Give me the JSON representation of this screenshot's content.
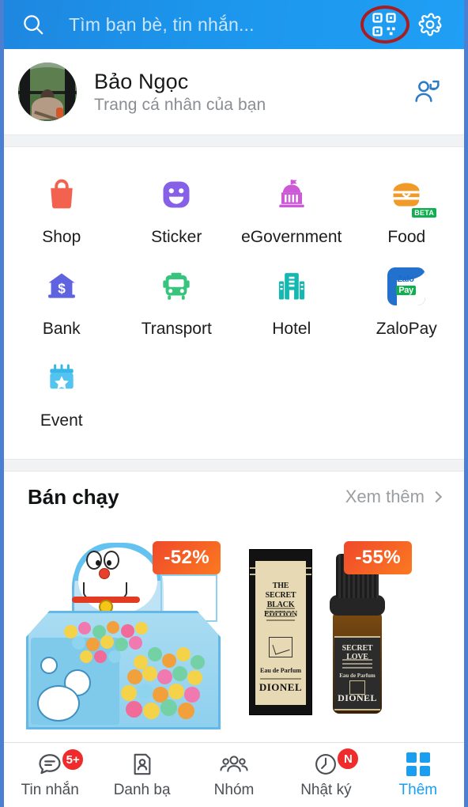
{
  "header": {
    "search_placeholder": "Tìm bạn bè, tin nhắn...",
    "search_icon": "search-icon",
    "qr_icon": "qr-code-icon",
    "settings_icon": "gear-icon",
    "background_color": "#1c96ec",
    "annotation_color": "#a81d20"
  },
  "profile": {
    "name": "Bảo Ngọc",
    "subtitle": "Trang cá nhân của bạn",
    "avatar_icon": "avatar",
    "switch_account_icon": "switch-account-icon"
  },
  "mini_apps": [
    {
      "label": "Shop",
      "icon": "shopping-bag-icon",
      "color": "#f2624f",
      "badge": ""
    },
    {
      "label": "Sticker",
      "icon": "smiley-sticker-icon",
      "color": "#8661e8",
      "badge": ""
    },
    {
      "label": "eGovernment",
      "icon": "government-building-icon",
      "color": "#cc5ad6",
      "badge": ""
    },
    {
      "label": "Food",
      "icon": "burger-icon",
      "color": "#f29a28",
      "badge": "BETA"
    },
    {
      "label": "Bank",
      "icon": "bank-dollar-icon",
      "color": "#5f63e0",
      "badge": ""
    },
    {
      "label": "Transport",
      "icon": "bus-icon",
      "color": "#39c47e",
      "badge": ""
    },
    {
      "label": "Hotel",
      "icon": "hotel-building-icon",
      "color": "#14b8b0",
      "badge": ""
    },
    {
      "label": "ZaloPay",
      "icon": "zalopay-icon",
      "color": "#2272cd",
      "badge": ""
    },
    {
      "label": "Event",
      "icon": "calendar-star-icon",
      "color": "#36b7e8",
      "badge": ""
    }
  ],
  "zalopay_tile": {
    "top_text": "Zalo",
    "bottom_text": "Pay"
  },
  "best_sellers": {
    "title": "Bán chạy",
    "more_label": "Xem thêm",
    "more_icon": "chevron-right-icon",
    "products": [
      {
        "discount": "-52%",
        "image_name": "doraemon-ball-pit-tent-image"
      },
      {
        "discount": "-55%",
        "image_name": "dionel-secret-love-perfume-image",
        "box_title_line1": "THE SECRET",
        "box_title_line2": "BLACK EDITION",
        "box_edp": "Eau de Parfum",
        "box_brand": "DIONEL",
        "bottle_title": "SECRET LOVE",
        "bottle_edp": "Eau de Parfum",
        "bottle_brand": "DIONEL"
      },
      {
        "discount": "",
        "image_name": "white-earphone-image"
      }
    ]
  },
  "bottom_nav": [
    {
      "label": "Tin nhắn",
      "icon": "chat-bubble-icon",
      "badge": "5+",
      "active": false
    },
    {
      "label": "Danh bạ",
      "icon": "contact-card-icon",
      "badge": "",
      "active": false
    },
    {
      "label": "Nhóm",
      "icon": "group-people-icon",
      "badge": "",
      "active": false
    },
    {
      "label": "Nhật ký",
      "icon": "clock-timeline-icon",
      "badge": "N",
      "active": false
    },
    {
      "label": "Thêm",
      "icon": "grid-squares-icon",
      "badge": "",
      "active": true
    }
  ]
}
